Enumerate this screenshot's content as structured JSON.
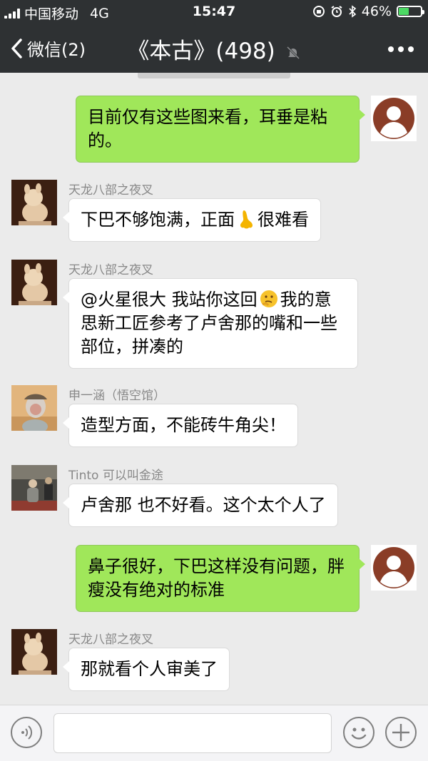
{
  "status_bar": {
    "carrier": "中国移动",
    "network": "4G",
    "time": "15:47",
    "battery": "46%",
    "battery_level": 0.46
  },
  "navbar": {
    "back_label": "微信(2)",
    "title": "《本古》(498)"
  },
  "messages": [
    {
      "side": "out",
      "text": "目前仅有这些图来看，耳垂是粘的。"
    },
    {
      "side": "in",
      "sender": "天龙八部之夜叉",
      "text_before": "下巴不够饱满，正面",
      "emoji": "nose-emoji",
      "text_after": "很难看"
    },
    {
      "side": "in",
      "sender": "天龙八部之夜叉",
      "text_before": "@火星很大 我站你这回",
      "emoji": "thinking-emoji",
      "text_after": "我的意思新工匠参考了卢舍那的嘴和一些部位，拼凑的"
    },
    {
      "side": "in",
      "sender": "申一涵（悟空馆）",
      "text": "造型方面，不能砖牛角尖！"
    },
    {
      "side": "in",
      "sender": "Tinto 可以叫金途",
      "text": "卢舍那 也不好看。这个太个人了"
    },
    {
      "side": "out",
      "text": "鼻子很好，下巴这样没有问题，胖瘦没有绝对的标准"
    },
    {
      "side": "in",
      "sender": "天龙八部之夜叉",
      "text": "那就看个人审美了"
    }
  ],
  "input_bar": {
    "placeholder": "",
    "left_icon": "voice-icon",
    "emoji_icon": "emoji-face-icon",
    "plus_icon": "plus-icon"
  },
  "colors": {
    "header_bg": "#2e3133",
    "chat_bg": "#ebebeb",
    "outgoing_bubble": "#a0e75a",
    "incoming_bubble": "#ffffff",
    "battery_fill": "#4cd964"
  }
}
